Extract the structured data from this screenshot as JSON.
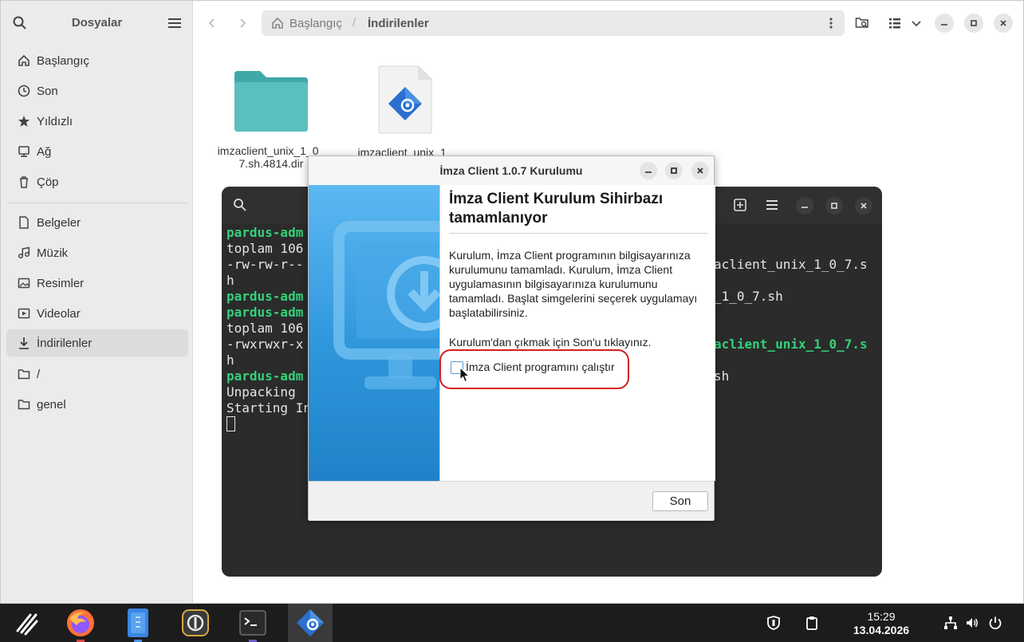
{
  "files": {
    "sidebar": {
      "title": "Dosyalar",
      "items": [
        {
          "label": "Başlangıç",
          "icon": "home-icon"
        },
        {
          "label": "Son",
          "icon": "clock-icon"
        },
        {
          "label": "Yıldızlı",
          "icon": "star-icon"
        },
        {
          "label": "Ağ",
          "icon": "network-icon"
        },
        {
          "label": "Çöp",
          "icon": "trash-icon"
        },
        {
          "label": "Belgeler",
          "icon": "document-icon"
        },
        {
          "label": "Müzik",
          "icon": "music-icon"
        },
        {
          "label": "Resimler",
          "icon": "image-icon"
        },
        {
          "label": "Videolar",
          "icon": "video-icon"
        },
        {
          "label": "İndirilenler",
          "icon": "download-icon"
        },
        {
          "label": "/",
          "icon": "folder-icon"
        },
        {
          "label": "genel",
          "icon": "folder-icon"
        }
      ]
    },
    "path": {
      "segment1": "Başlangıç",
      "separator": "/",
      "segment2": "İndirilenler"
    },
    "grid": [
      {
        "name": "imzaclient_unix_1_0_7.sh.4814.dir",
        "kind": "folder"
      },
      {
        "name": "imzaclient_unix_1_",
        "kind": "installer"
      }
    ]
  },
  "terminal": {
    "left_lines": [
      {
        "text": "pardus-adm",
        "green": true
      },
      {
        "text": "toplam 106",
        "green": false
      },
      {
        "text": "-rw-rw-r--",
        "green": false
      },
      {
        "text": "h",
        "green": false
      },
      {
        "text": "pardus-adm",
        "green": true
      },
      {
        "text": "pardus-adm",
        "green": true
      },
      {
        "text": "toplam 106",
        "green": false
      },
      {
        "text": "-rwxrwxr-x",
        "green": false
      },
      {
        "text": "h",
        "green": false
      },
      {
        "text": "pardus-adm",
        "green": true
      },
      {
        "text": "Unpacking",
        "green": false
      },
      {
        "text": "Starting In",
        "green": false
      }
    ],
    "right_lines": [
      {
        "text": "aclient_unix_1_0_7.s",
        "green": false
      },
      {
        "text": "",
        "green": false
      },
      {
        "text": "_1_0_7.sh",
        "green": false
      },
      {
        "text": "",
        "green": false
      },
      {
        "text": "",
        "green": false
      },
      {
        "text": "aclient_unix_1_0_7.s",
        "green": true
      },
      {
        "text": "",
        "green": false
      },
      {
        "text": "sh",
        "green": false
      }
    ]
  },
  "dialog": {
    "title": "İmza Client 1.0.7 Kurulumu",
    "heading": "İmza Client Kurulum Sihirbazı tamamlanıyor",
    "paragraph1": "Kurulum, İmza Client programının bilgisayarınıza kurulumunu tamamladı. Kurulum, İmza Client uygulamasının bilgisayarınıza kurulumunu tamamladı. Başlat simgelerini seçerek uygulamayı başlatabilirsiniz.",
    "paragraph2": "Kurulum'dan çıkmak için Son'u tıklayınız.",
    "checkbox_label": "İmza Client programını çalıştır",
    "checkbox_checked": false,
    "finish_button": "Son"
  },
  "taskbar": {
    "apps": [
      "pardus-menu-icon",
      "firefox-icon",
      "files-icon",
      "password-manager-icon",
      "terminal-icon",
      "imza-client-icon"
    ],
    "time": "15:29",
    "date": "13.04.2026"
  },
  "colors": {
    "accent": "#3584e4",
    "terminal_green": "#33d17a",
    "highlight_ring": "#d42020",
    "folder": "#5bbfbf"
  }
}
